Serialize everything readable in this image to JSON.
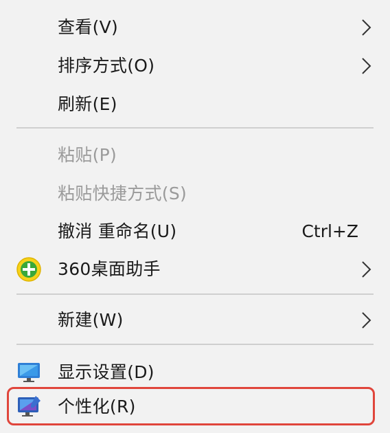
{
  "menu": {
    "items": [
      {
        "label": "查看(V)",
        "submenu": true
      },
      {
        "label": "排序方式(O)",
        "submenu": true
      },
      {
        "label": "刷新(E)"
      },
      {
        "label": "粘贴(P)",
        "disabled": true
      },
      {
        "label": "粘贴快捷方式(S)",
        "disabled": true
      },
      {
        "label": "撤消 重命名(U)",
        "shortcut": "Ctrl+Z"
      },
      {
        "label": "360桌面助手",
        "icon": "360-plus-icon",
        "submenu": true
      },
      {
        "label": "新建(W)",
        "submenu": true
      },
      {
        "label": "显示设置(D)",
        "icon": "display-settings-icon"
      },
      {
        "label": "个性化(R)",
        "icon": "personalize-icon",
        "highlighted": true
      }
    ]
  },
  "colors": {
    "background": "#f2f2f2",
    "text": "#1a1a1a",
    "disabled_text": "#9a9a9a",
    "highlight_border": "#e0453b"
  }
}
